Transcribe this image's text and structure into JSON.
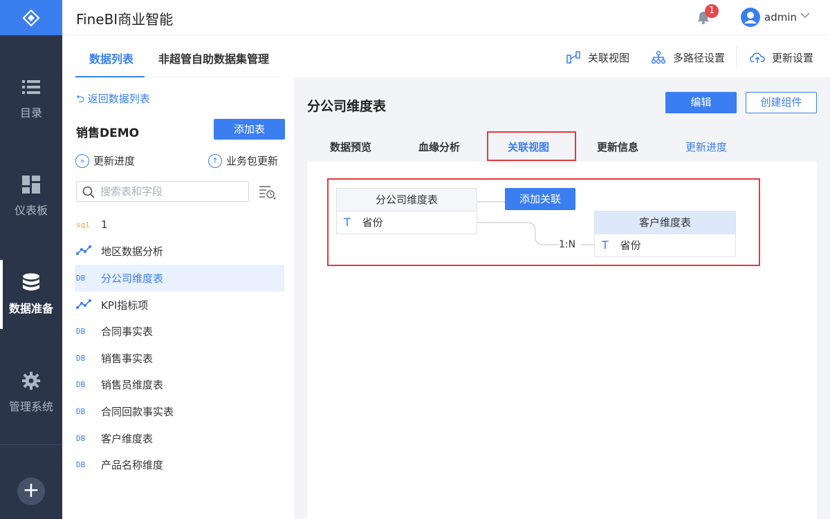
{
  "topbar": {
    "app_title": "FineBI商业智能",
    "notification_count": "1",
    "user_name": "admin"
  },
  "nav": {
    "items": [
      {
        "label": "目录",
        "icon": "list-icon",
        "active": false
      },
      {
        "label": "仪表板",
        "icon": "dashboard-icon",
        "active": false
      },
      {
        "label": "数据准备",
        "icon": "database-icon",
        "active": true
      },
      {
        "label": "管理系统",
        "icon": "gear-icon",
        "active": false
      }
    ],
    "add_label": "+"
  },
  "page_tabs": {
    "tab1": "数据列表",
    "tab2": "非超管自助数据集管理",
    "active": "数据列表"
  },
  "toolbar": {
    "relation_view": "关联视图",
    "multipath": "多路径设置",
    "update_settings": "更新设置"
  },
  "left_panel": {
    "back_label": "返回数据列表",
    "package_name": "销售DEMO",
    "add_table_label": "添加表",
    "update_progress_label": "更新进度",
    "package_update_label": "业务包更新",
    "search_placeholder": "搜索表和字段",
    "tables": [
      {
        "type": "SQL",
        "type_label": "sql",
        "name": "1"
      },
      {
        "type": "Analysis",
        "type_label": "",
        "name": "地区数据分析"
      },
      {
        "type": "DB",
        "type_label": "DB",
        "name": "分公司维度表",
        "active": true
      },
      {
        "type": "Analysis",
        "type_label": "",
        "name": "KPI指标项"
      },
      {
        "type": "DB",
        "type_label": "DB",
        "name": "合同事实表"
      },
      {
        "type": "DB",
        "type_label": "DB",
        "name": "销售事实表"
      },
      {
        "type": "DB",
        "type_label": "DB",
        "name": "销售员维度表"
      },
      {
        "type": "DB",
        "type_label": "DB",
        "name": "合同回款事实表"
      },
      {
        "type": "DB",
        "type_label": "DB",
        "name": "客户维度表"
      },
      {
        "type": "DB",
        "type_label": "DB",
        "name": "产品名称维度"
      }
    ]
  },
  "right_panel": {
    "table_title": "分公司维度表",
    "edit_label": "编辑",
    "create_component_label": "创建组件",
    "subtabs": {
      "preview": "数据预览",
      "lineage": "血缘分析",
      "relation": "关联视图",
      "update_info": "更新信息",
      "update_progress": "更新进度"
    },
    "active_subtab": "关联视图",
    "relation_view": {
      "source_table": "分公司维度表",
      "source_field": "省份",
      "source_field_type": "T",
      "add_relation_label": "添加关联",
      "cardinality": "1:N",
      "target_table": "客户维度表",
      "target_field": "省份",
      "target_field_type": "T"
    }
  },
  "colors": {
    "accent": "#3a7ef0",
    "nav_bg": "#2b3549",
    "highlight_red": "#e5383b"
  }
}
